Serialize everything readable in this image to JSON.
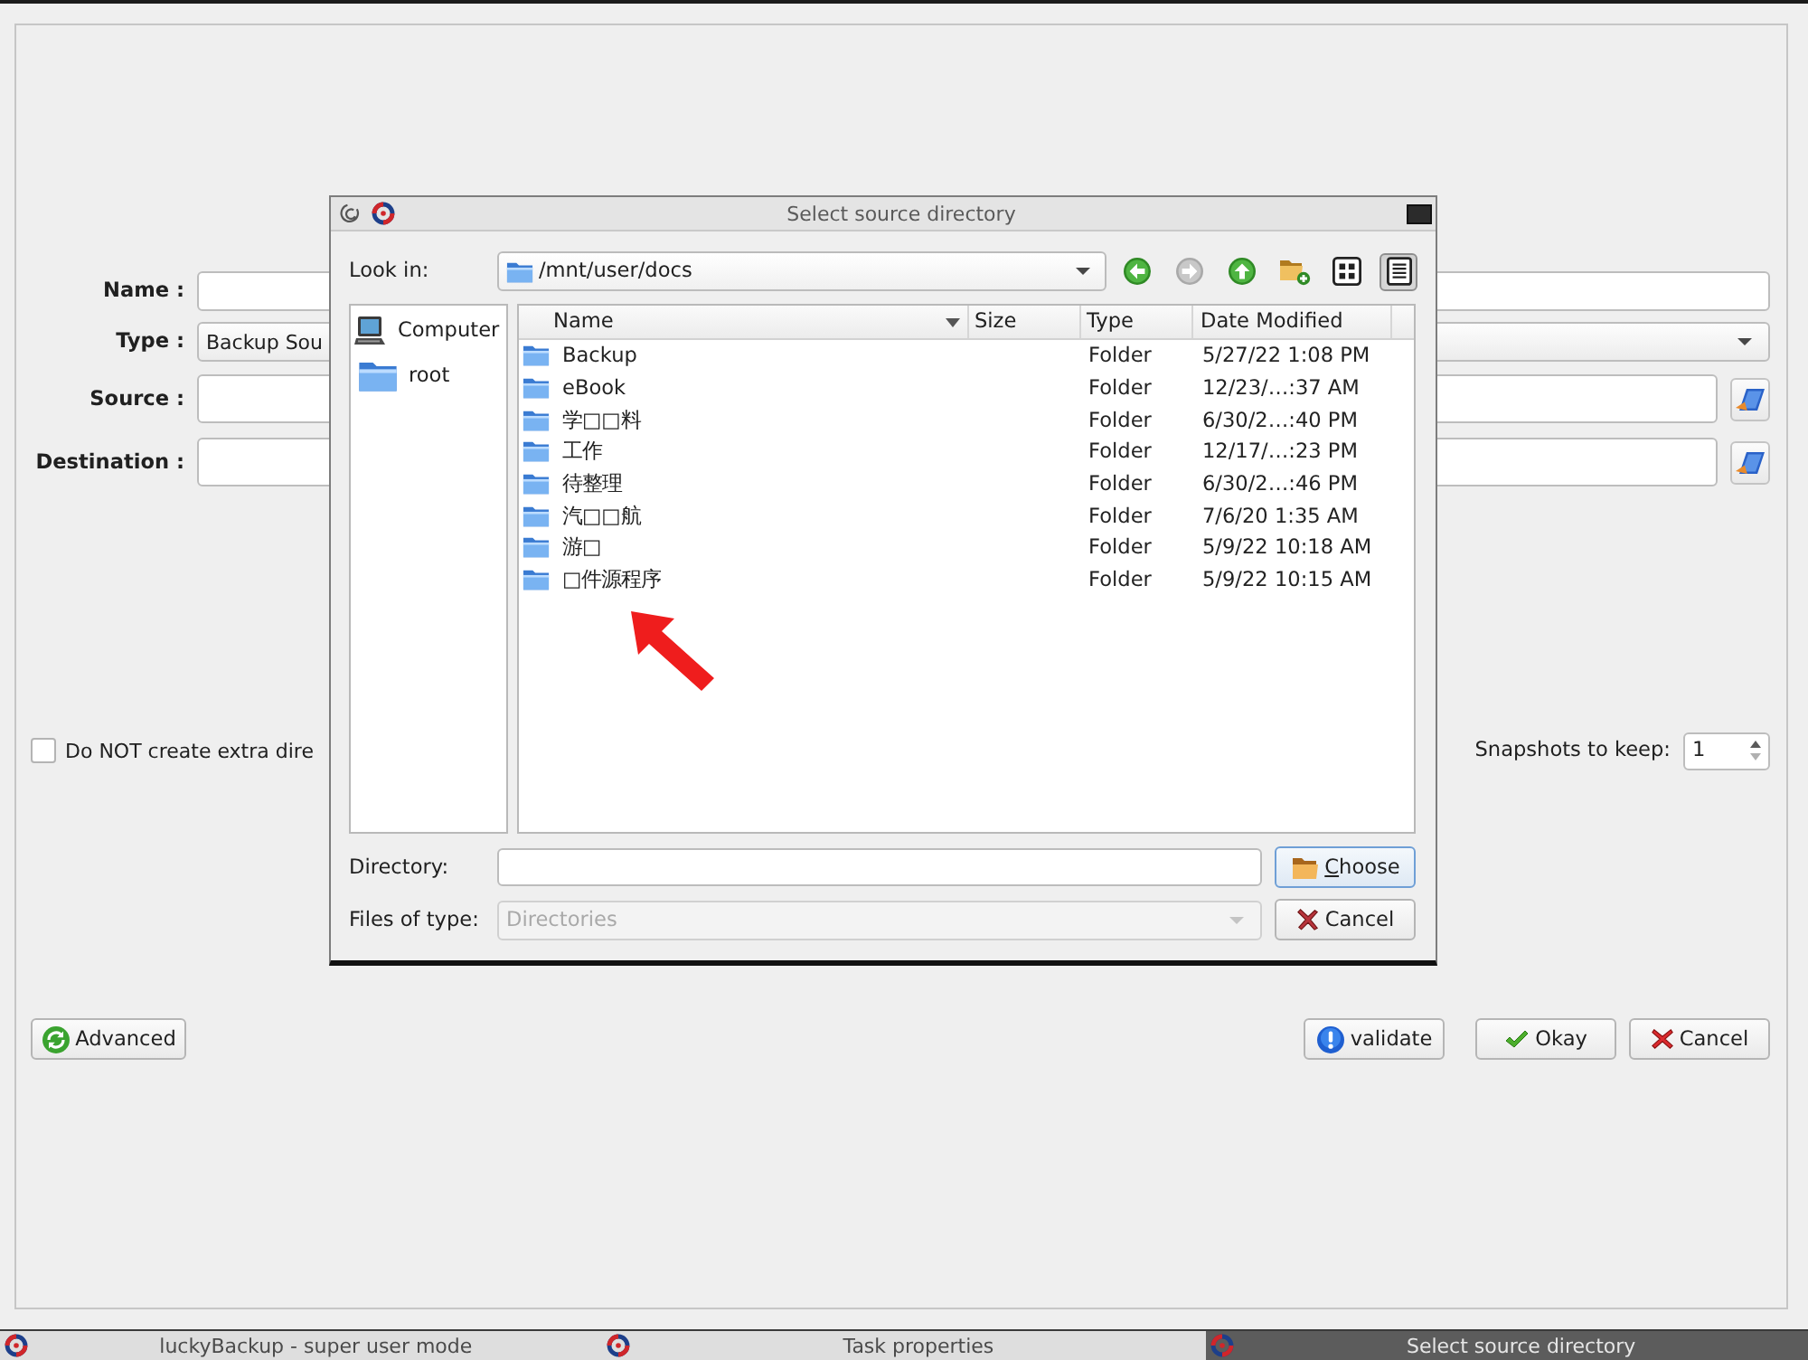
{
  "main_window": {
    "fields": [
      {
        "kind": "text",
        "label": "Name :"
      },
      {
        "kind": "combo",
        "label": "Type :",
        "value": "Backup Sou"
      },
      {
        "kind": "path",
        "label": "Source :"
      },
      {
        "kind": "path",
        "label": "Destination :"
      }
    ],
    "option": {
      "label": "Do NOT create extra dire",
      "checked": false
    },
    "snapshots": {
      "label": "Snapshots to keep:",
      "value": "1"
    },
    "buttons": [
      {
        "kind": "advanced",
        "label": "Advanced"
      },
      {
        "kind": "validate",
        "label": "validate"
      },
      {
        "kind": "okay",
        "label": "Okay"
      },
      {
        "kind": "cancel",
        "label": "Cancel"
      }
    ]
  },
  "dialog": {
    "title": "Select source directory",
    "look_in": {
      "label": "Look in:",
      "value": "/mnt/user/docs"
    },
    "nav_buttons": [
      {
        "kind": "back",
        "disabled": false
      },
      {
        "kind": "forward",
        "disabled": true
      },
      {
        "kind": "up",
        "disabled": false
      },
      {
        "kind": "new_folder",
        "disabled": false
      }
    ],
    "view_buttons": [
      {
        "kind": "icons",
        "selected": false
      },
      {
        "kind": "details",
        "selected": true
      }
    ],
    "sidebar": {
      "items": [
        {
          "kind": "computer",
          "label": "Computer",
          "selected": false
        },
        {
          "kind": "folder",
          "label": "root",
          "selected": false
        }
      ]
    },
    "file_list": {
      "columns": [
        {
          "label": "Name",
          "sorted": true
        },
        {
          "label": "Size",
          "sorted": false
        },
        {
          "label": "Type",
          "sorted": false
        },
        {
          "label": "Date Modified",
          "sorted": false
        }
      ],
      "rows": [
        {
          "kind": "folder",
          "name": "Backup",
          "type": "Folder",
          "date_modified": "5/27/22 1:08 PM",
          "selected": false
        },
        {
          "kind": "folder",
          "name": "eBook",
          "type": "Folder",
          "date_modified": "12/23/…:37 AM",
          "selected": false
        },
        {
          "kind": "folder",
          "name": "学□□料",
          "type": "Folder",
          "date_modified": "6/30/2…:40 PM",
          "selected": false
        },
        {
          "kind": "folder",
          "name": "工作",
          "type": "Folder",
          "date_modified": "12/17/…:23 PM",
          "selected": false
        },
        {
          "kind": "folder",
          "name": "待整理",
          "type": "Folder",
          "date_modified": "6/30/2…:46 PM",
          "selected": false
        },
        {
          "kind": "folder",
          "name": "汽□□航",
          "type": "Folder",
          "date_modified": "7/6/20 1:35 AM",
          "selected": false
        },
        {
          "kind": "folder",
          "name": "游□",
          "type": "Folder",
          "date_modified": "5/9/22 10:18 AM",
          "selected": false
        },
        {
          "kind": "folder",
          "name": "□件源程序",
          "type": "Folder",
          "date_modified": "5/9/22 10:15 AM",
          "selected": false
        }
      ]
    },
    "directory": {
      "label": "Directory:"
    },
    "file_type": {
      "label": "Files of type:",
      "value": "Directories",
      "disabled": true
    },
    "buttons": [
      {
        "kind": "choose",
        "label": "Choose",
        "default": true,
        "mnemonic_underlined": true
      },
      {
        "kind": "cancel",
        "label": "Cancel",
        "default": false,
        "mnemonic_underlined": false
      }
    ]
  },
  "annotation": {
    "kind": "arrow"
  },
  "taskbar": {
    "items": [
      {
        "label": "luckyBackup - super user mode",
        "selected": false
      },
      {
        "label": "Task properties",
        "selected": false
      },
      {
        "label": "Select source directory",
        "selected": true
      }
    ]
  }
}
